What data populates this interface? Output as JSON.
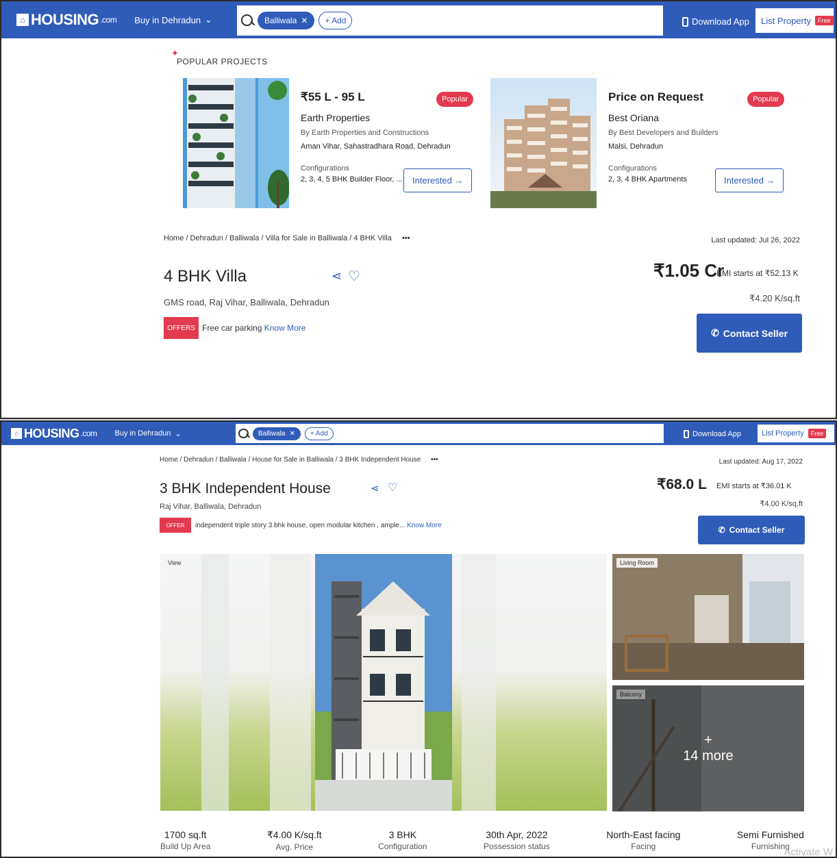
{
  "common": {
    "brand": "HOUSING",
    "brand_suffix": ".com",
    "city_selector": "Buy in Dehradun",
    "search_chip": "Balliwala",
    "add_chip": "+ Add",
    "download_app": "Download App",
    "list_property": "List Property",
    "free_badge": "Free",
    "colors": {
      "brand_blue": "#2f5cb8",
      "badge_red": "#e23a4e"
    }
  },
  "shot1": {
    "popular_title": "POPULAR PROJECTS",
    "projects": [
      {
        "price": "₹55 L - 95 L",
        "badge": "Popular",
        "name": "Earth Properties",
        "by": "By Earth Properties and Constructions",
        "location": "Aman Vihar, Sahastradhara Road, Dehradun",
        "config_label": "Configurations",
        "config_value": "2, 3, 4, 5 BHK Builder Floor, ...",
        "button": "Interested →"
      },
      {
        "price": "Price on Request",
        "badge": "Popular",
        "name": "Best Oriana",
        "by": "By Best Developers and Builders",
        "location": "Malsi, Dehradun",
        "config_label": "Configurations",
        "config_value": "2, 3, 4 BHK Apartments",
        "button": "Interested →"
      }
    ],
    "breadcrumb": "Home / Dehradun / Balliwala / Villa for Sale in Balliwala / 4 BHK Villa",
    "breadcrumb_more": "•••",
    "last_updated": "Last updated: Jul 26, 2022",
    "title": "4 BHK Villa",
    "address": "GMS road, Raj Vihar, Balliwala, Dehradun",
    "offer_badge": "OFFERS",
    "offer_text": "Free car parking",
    "know_more": "Know More",
    "price": "₹1.05 Cr",
    "emi": "EMI starts at ₹52.13 K",
    "per_sqft": "₹4.20 K/sq.ft",
    "contact": "Contact Seller"
  },
  "shot2": {
    "breadcrumb": "Home / Dehradun / Balliwala / House for Sale in Balliwala / 3 BHK Independent House",
    "breadcrumb_more": "•••",
    "last_updated": "Last updated: Aug 17, 2022",
    "title": "3 BHK Independent House",
    "address": "Raj Vihar, Balliwala, Dehradun",
    "offer_badge": "OFFER",
    "offer_text": "independent triple story 3 bhk house, open modular kitchen , ample...",
    "know_more": "Know More",
    "price": "₹68.0 L",
    "emi": "EMI starts at ₹36.01 K",
    "per_sqft": "₹4.00 K/sq.ft",
    "contact": "Contact Seller",
    "gallery": {
      "main_label": "View",
      "side1_label": "Living Room",
      "side2_label": "Balcony",
      "more_plus": "+",
      "more_text": "14 more"
    },
    "stats": [
      {
        "value": "1700 sq.ft",
        "label": "Build Up Area"
      },
      {
        "value": "₹4.00 K/sq.ft",
        "label": "Avg. Price"
      },
      {
        "value": "3 BHK",
        "label": "Configuration"
      },
      {
        "value": "30th Apr, 2022",
        "label": "Possession status"
      },
      {
        "value": "North-East facing",
        "label": "Facing"
      },
      {
        "value": "Semi Furnished",
        "label": "Furnishing"
      }
    ],
    "watermark": "Activate W"
  }
}
